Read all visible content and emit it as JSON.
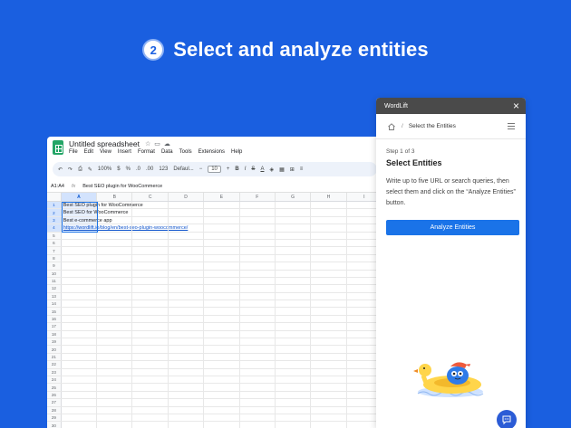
{
  "hero": {
    "step_number": "2",
    "title": "Select and analyze entities"
  },
  "sheet": {
    "doc_title": "Untitled spreadsheet",
    "menu": [
      "File",
      "Edit",
      "View",
      "Insert",
      "Format",
      "Data",
      "Tools",
      "Extensions",
      "Help"
    ],
    "toolbar": {
      "zoom": "100%",
      "currency": "$",
      "percent": "%",
      "dec1": ".0",
      "dec2": ".00",
      "num": "123",
      "font": "Defaul...",
      "font_size": "10"
    },
    "cell_ref": "A1:A4",
    "fx": "fx",
    "formula": "Best SEO plugin for WooCommerce",
    "columns": [
      "A",
      "B",
      "C",
      "D",
      "E",
      "F",
      "G",
      "H",
      "I"
    ],
    "rows": [
      {
        "num": "1",
        "a": "Best SEO plugin for WooCommerce",
        "link": false
      },
      {
        "num": "2",
        "a": "Best SEO for WooCommerce",
        "link": false
      },
      {
        "num": "3",
        "a": "Best e-commerce app",
        "link": false
      },
      {
        "num": "4",
        "a": "https://wordlift.io/blog/en/best-seo-plugin-woocommerce/",
        "link": true
      },
      {
        "num": "5"
      },
      {
        "num": "6"
      },
      {
        "num": "7"
      },
      {
        "num": "8"
      },
      {
        "num": "9"
      },
      {
        "num": "10"
      },
      {
        "num": "11"
      },
      {
        "num": "12"
      },
      {
        "num": "13"
      },
      {
        "num": "14"
      },
      {
        "num": "15"
      },
      {
        "num": "16"
      },
      {
        "num": "17"
      },
      {
        "num": "18"
      },
      {
        "num": "19"
      },
      {
        "num": "20"
      },
      {
        "num": "21"
      },
      {
        "num": "22"
      },
      {
        "num": "23"
      },
      {
        "num": "24"
      },
      {
        "num": "25"
      },
      {
        "num": "26"
      },
      {
        "num": "27"
      },
      {
        "num": "28"
      },
      {
        "num": "29"
      },
      {
        "num": "30"
      },
      {
        "num": "31"
      }
    ]
  },
  "panel": {
    "title": "WordLift",
    "breadcrumb_sep": "/",
    "breadcrumb": "Select the Entities",
    "step": "Step 1 of 3",
    "heading": "Select Entities",
    "description": "Write up to five URL or search queries, then select them and click on the “Analyze Entities” button.",
    "button": "Analyze Entities"
  },
  "colors": {
    "background": "#1a5fe0",
    "accent": "#1a73e8",
    "panel_header": "#4a4a4a"
  }
}
